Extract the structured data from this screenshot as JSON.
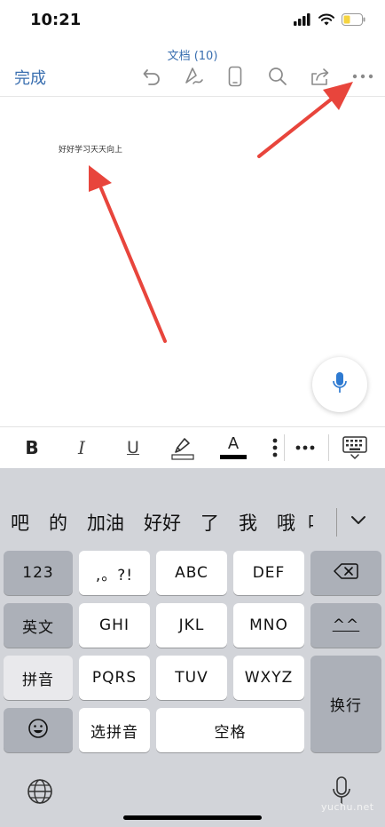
{
  "status_bar": {
    "time": "10:21",
    "icons": [
      "signal-icon",
      "wifi-icon",
      "battery-icon"
    ],
    "battery_color": "#f5d440"
  },
  "header": {
    "title": "文档 (10)",
    "done_label": "完成",
    "icons": [
      "undo-icon",
      "draw-pen-icon",
      "mobile-view-icon",
      "search-icon",
      "share-icon",
      "more-icon"
    ]
  },
  "document": {
    "text": "好好学习天天向上"
  },
  "format_bar": {
    "bold": "B",
    "italic": "I",
    "underline": "U",
    "font_color_letter": "A",
    "icons": [
      "highlighter-icon",
      "font-color-icon",
      "overflow-dots-icon",
      "more-icon",
      "keyboard-dismiss-icon"
    ]
  },
  "candidates": [
    "吧",
    "的",
    "加油",
    "好好",
    "了",
    "我",
    "哦",
    "吖"
  ],
  "keyboard": {
    "row1": [
      "123",
      ",。?!",
      "ABC",
      "DEF"
    ],
    "row2": [
      "英文",
      "GHI",
      "JKL",
      "MNO",
      "^^"
    ],
    "row3": [
      "拼音",
      "PQRS",
      "TUV",
      "WXYZ"
    ],
    "row4": [
      "选拼音",
      "空格"
    ],
    "return_label": "换行",
    "icons": [
      "delete-icon",
      "emoji-icon",
      "globe-icon",
      "dictation-mic-icon",
      "chevron-down-icon"
    ]
  },
  "watermark": "yuchu.net",
  "colors": {
    "accent": "#3a6fb0",
    "arrow": "#e8453c",
    "keyboard_bg": "#d2d4d9"
  }
}
